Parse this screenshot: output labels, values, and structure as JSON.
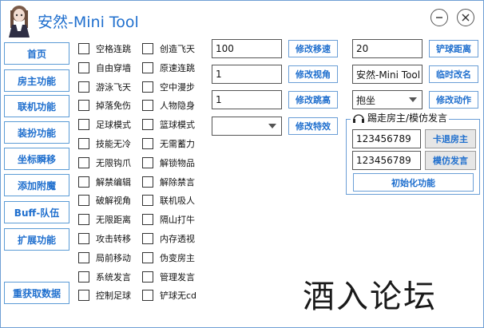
{
  "window": {
    "title": "安然-Mini Tool"
  },
  "nav": [
    {
      "label": "首页"
    },
    {
      "label": "房主功能"
    },
    {
      "label": "联机功能"
    },
    {
      "label": "装扮功能"
    },
    {
      "label": "坐标瞬移"
    },
    {
      "label": "添加附魔"
    },
    {
      "label": "Buff-队伍"
    },
    {
      "label": "扩展功能"
    }
  ],
  "reload_label": "重获取数据",
  "col1": [
    "空格连跳",
    "自由穿墙",
    "游泳飞天",
    "掉落免伤",
    "足球模式",
    "技能无冷",
    "无限钩爪",
    "解禁编辑",
    "破解视角",
    "无限距离",
    "攻击转移",
    "局前移动",
    "系统发言",
    "控制足球"
  ],
  "col2": [
    "创造飞天",
    "原速连跳",
    "空中漫步",
    "人物隐身",
    "篮球模式",
    "无需蓄力",
    "解锁物品",
    "解除禁言",
    "联机吸人",
    "隔山打牛",
    "内存透视",
    "伪变房主",
    "管理发言",
    "铲球无cd"
  ],
  "mid": {
    "speed_value": "100",
    "speed_btn": "修改移速",
    "view_value": "1",
    "view_btn": "修改视角",
    "jump_value": "1",
    "jump_btn": "修改跳高",
    "effect_value": "",
    "effect_btn": "修改特效"
  },
  "right": {
    "tackle_value": "20",
    "tackle_btn": "铲球距离",
    "name_value": "安然-Mini Tool",
    "name_btn": "临时改名",
    "action_value": "抱坐",
    "action_btn": "修改动作"
  },
  "group": {
    "title": "踢走房主/模仿发言",
    "id1": "123456789",
    "btn1": "卡退房主",
    "id2": "123456789",
    "btn2": "模仿发言",
    "init_btn": "初始化功能"
  },
  "watermark": "酒入论坛",
  "icons": {
    "minimize": "minimize-icon",
    "close": "close-icon",
    "avatar": "anime-girl-avatar",
    "headset": "headset-icon"
  },
  "colors": {
    "accent": "#1f6fce",
    "border": "#6a9ed6"
  }
}
